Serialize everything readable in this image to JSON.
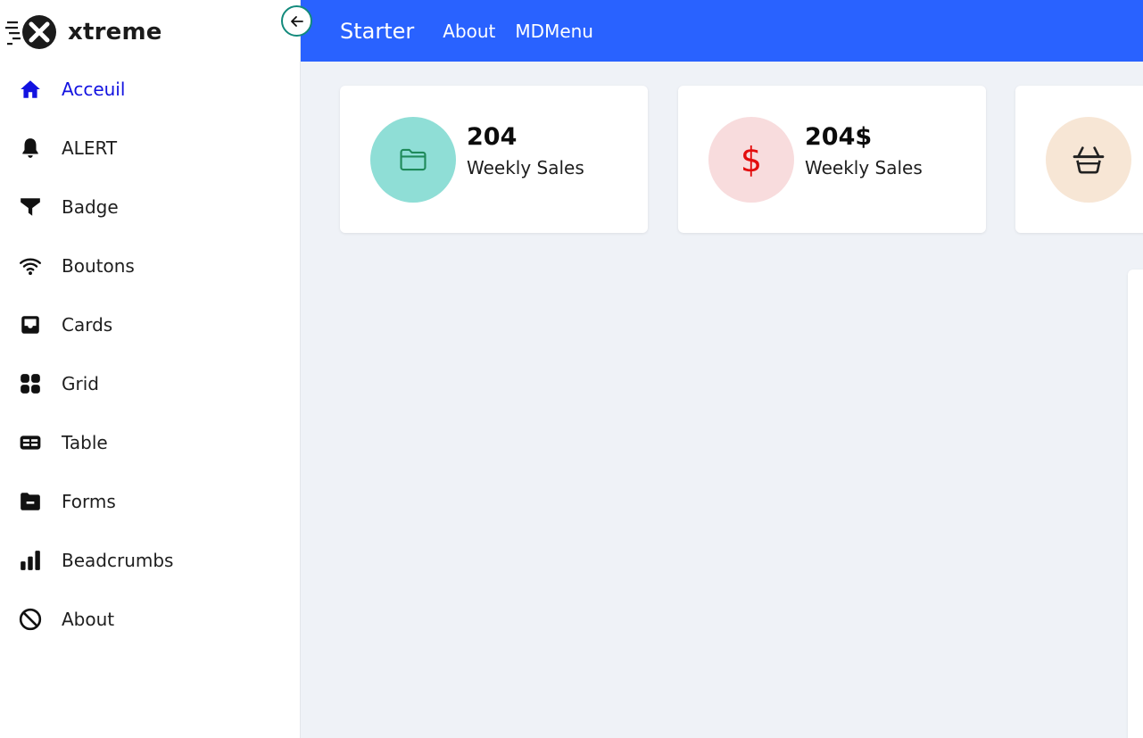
{
  "brand": {
    "name": "xtreme",
    "logo_icon": "x-logo-icon"
  },
  "sidebar": {
    "toggle_icon": "arrow-left-icon",
    "items": [
      {
        "label": "Acceuil",
        "icon": "home-icon",
        "active": true
      },
      {
        "label": "ALERT",
        "icon": "bell-icon",
        "active": false
      },
      {
        "label": "Badge",
        "icon": "funnel-icon",
        "active": false
      },
      {
        "label": "Boutons",
        "icon": "wifi-icon",
        "active": false
      },
      {
        "label": "Cards",
        "icon": "inbox-icon",
        "active": false
      },
      {
        "label": "Grid",
        "icon": "grid-icon",
        "active": false
      },
      {
        "label": "Table",
        "icon": "table-icon",
        "active": false
      },
      {
        "label": "Forms",
        "icon": "folder-icon",
        "active": false
      },
      {
        "label": "Beadcrumbs",
        "icon": "bar-chart-icon",
        "active": false
      },
      {
        "label": "About",
        "icon": "ban-icon",
        "active": false
      }
    ]
  },
  "topbar": {
    "title": "Starter",
    "links": [
      "About",
      "MDMenu"
    ],
    "color": "#2962ff"
  },
  "cards": [
    {
      "value": "204",
      "label": "Weekly Sales",
      "icon": "folder-outline-icon",
      "bg": "#8fded6",
      "icon_color": "#1f8a5a"
    },
    {
      "value": "204$",
      "label": "Weekly Sales",
      "icon": "dollar-icon",
      "bg": "#f8dcdd",
      "icon_color": "#e30d0d"
    },
    {
      "value": "",
      "label": "",
      "icon": "basket-icon",
      "bg": "#f7e6d5",
      "icon_color": "#222222"
    }
  ]
}
